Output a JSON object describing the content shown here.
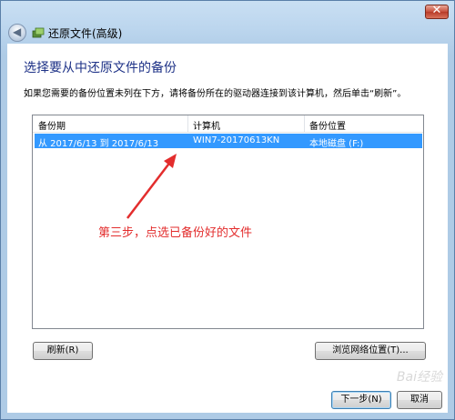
{
  "window": {
    "title": "还原文件(高级)",
    "close_glyph": "✕"
  },
  "heading": "选择要从中还原文件的备份",
  "description": "如果您需要的备份位置未列在下方，请将备份所在的驱动器连接到该计算机，然后单击“刷新”。",
  "table": {
    "columns": [
      "备份期",
      "计算机",
      "备份位置"
    ],
    "rows": [
      {
        "period": "从 2017/6/13 到 2017/6/13",
        "computer": "WIN7-20170613KN",
        "location": "本地磁盘 (F:)",
        "selected": true
      }
    ]
  },
  "annotation": "第三步，点选已备份好的文件",
  "buttons": {
    "refresh": "刷新(R)",
    "browse": "浏览网络位置(T)...",
    "next": "下一步(N)",
    "cancel": "取消"
  },
  "watermark": "Bai经验",
  "colors": {
    "accent": "#3399ff",
    "heading": "#1e3287",
    "annotation": "#e32d2d"
  }
}
